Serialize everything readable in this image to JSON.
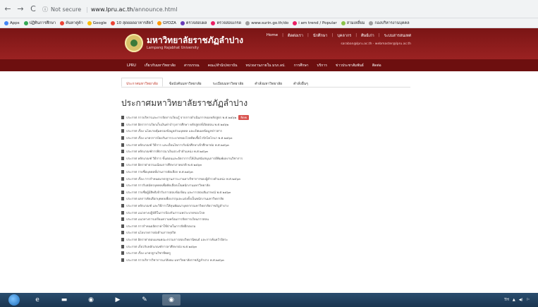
{
  "browser": {
    "back_icon": "←",
    "forward_icon": "→",
    "reload_icon": "C",
    "security_text": "Not secure",
    "host": "www.lpru.ac.th",
    "path": "/announce.html",
    "bookmarks": [
      {
        "label": "Apps",
        "color": "#4285f4"
      },
      {
        "label": "ปฏิทินการศึกษา",
        "color": "#34a853"
      },
      {
        "label": "ค้นหาคู่ค้า",
        "color": "#ea4335"
      },
      {
        "label": "Google",
        "color": "#fbbc05"
      },
      {
        "label": "10 สุดยอดอาหารสัตว์",
        "color": "#ea4335"
      },
      {
        "label": "GYOZA",
        "color": "#ff9800"
      },
      {
        "label": "ตรวจสอบผล",
        "color": "#673ab7"
      },
      {
        "label": "ตรวจสอบเกรด",
        "color": "#e91e63"
      },
      {
        "label": "www.surin.go.th/do",
        "color": "#9e9e9e"
      },
      {
        "label": "i am trend / Popular",
        "color": "#e91e63"
      },
      {
        "label": "สามเหลี่ยม",
        "color": "#8bc34a"
      },
      {
        "label": "กองบริหารงานบุคคล",
        "color": "#9e9e9e"
      }
    ]
  },
  "site": {
    "name": "มหาวิทยาลัยราชภัฏลำปาง",
    "subname": "Lampang Rajabhat University",
    "top_links": [
      "Home",
      "ติดต่อเรา",
      "นักศึกษา",
      "บุคลากร",
      "ศิษย์เก่า",
      "ระบบสารสนเทศ"
    ],
    "contact": "saraban@lpru.ac.th · webmaster@lpru.ac.th",
    "menu": [
      "LPRU",
      "เกี่ยวกับมหาวิทยาลัย",
      "สารบรรณ",
      "คณะ/สำนัก/สถาบัน",
      "หน่วยงานภายใน มรภ.ลป.",
      "การศึกษา",
      "บริการ",
      "ข่าวประชาสัมพันธ์",
      "ติดต่อ"
    ]
  },
  "tabs": [
    {
      "label": "ประกาศมหาวิทยาลัย",
      "active": true
    },
    {
      "label": "ข้อบังคับมหาวิทยาลัย",
      "active": false
    },
    {
      "label": "ระเบียบมหาวิทยาลัย",
      "active": false
    },
    {
      "label": "คำสั่งมหาวิทยาลัย",
      "active": false
    },
    {
      "label": "คำสั่งอื่นๆ",
      "active": false
    }
  ],
  "heading": "ประกาศมหาวิทยาลัยราชภัฏลำปาง",
  "new_badge": "New",
  "announcements": [
    "ประกาศ การบริหารและการจัดการเรียนรู้ จากการดำเนินการของหลักสูตร พ.ศ.๒๕๖๒",
    "ประกาศ อัตราการเรียกเก็บเงินค่าบำรุงการศึกษา หลักสูตรที่เปิดสอน พ.ศ.๒๕๖๒",
    "ประกาศ เรื่อง นโยบายคุ้มครองข้อมูลส่วนบุคคล และเปิดเผยข้อมูลข่าวสาร",
    "ประกาศ เรื่อง มาตรการป้องกันการระบาดของโรคติดเชื้อไวรัสโคโรนา พ.ศ.๒๕๖๓",
    "ประกาศ หลักเกณฑ์ วิธีการ และเงื่อนไขการรับนักศึกษาเข้าศึกษาต่อ พ.ศ.๒๕๖๓",
    "ประกาศ หลักเกณฑ์การพิจารณาเงินประจำตำแหน่ง พ.ศ.๒๕๖๓",
    "ประกาศ หลักเกณฑ์ วิธีการ ขั้นตอนและอัตราการให้เงินสนับสนุนการตีพิมพ์ผลงานวิชาการ",
    "ประกาศ อัตราค่าธรรมเนียมการศึกษาภาคปกติ พ.ศ.๒๕๖๓",
    "ประกาศ รายชื่อบุคคลที่ผ่านการคัดเลือก พ.ศ.๒๕๖๓",
    "ประกาศ เรื่อง การกำหนดมาตรฐานภาระงานทางวิชาการของผู้ดำรงตำแหน่ง พ.ศ.๒๕๖๓",
    "ประกาศ การรับสมัครบุคคลเพื่อคัดเลือกเป็นพนักงานมหาวิทยาลัย",
    "ประกาศ รายชื่อผู้มีสิทธิเข้ารับการสอบข้อเขียน และการสอบสัมภาษณ์ พ.ศ.๒๕๖๓",
    "ประกาศ ผลการคัดเลือกบุคคลเพื่อบรรจุและแต่งตั้งเป็นพนักงานมหาวิทยาลัย",
    "ประกาศ หลักเกณฑ์ และวิธีการให้ทุนพัฒนาบุคลากรมหาวิทยาลัยราชภัฏลำปาง",
    "ประกาศ แนวทางปฏิบัติในการป้องกันการแพร่ระบาดของโรค",
    "ประกาศ แนวทางการเตรียมความพร้อมการจัดการเรียนการสอน",
    "ประกาศ การกำหนดอัตราค่าใช้จ่ายในการจัดฝึกอบรม",
    "ประกาศ นโยบายการต่อต้านการทุจริต",
    "ประกาศ อัตราค่าตอบแทนคณะกรรมการสอบวิทยานิพนธ์ และการค้นคว้าอิสระ",
    "ประกาศ เกี่ยวกับหลักเกณฑ์การลาศึกษาต่อ พ.ศ.๒๕๖๓",
    "ประกาศ เรื่อง มาตรฐานวิชาชีพครู",
    "ประกาศ การบริการวิชาการแก่สังคม มหาวิทยาลัยราชภัฏลำปาง พ.ศ.๒๕๖๓"
  ],
  "taskbar": {
    "apps": [
      {
        "icon": "ie-icon",
        "glyph": "e"
      },
      {
        "icon": "folder-icon",
        "glyph": "▬"
      },
      {
        "icon": "chrome-icon",
        "glyph": "◉"
      },
      {
        "icon": "media-icon",
        "glyph": "▶"
      },
      {
        "icon": "paint-icon",
        "glyph": "✎"
      },
      {
        "icon": "chrome-active-icon",
        "glyph": "◉"
      }
    ],
    "tray": [
      "TH",
      "▲",
      "◀)",
      "⚐"
    ]
  }
}
